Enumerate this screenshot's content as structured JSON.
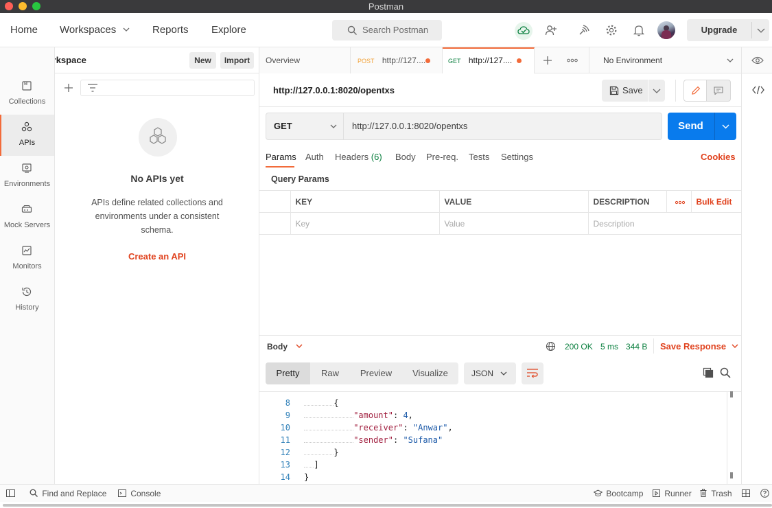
{
  "window": {
    "title": "Postman"
  },
  "topbar": {
    "nav": [
      "Home",
      "Workspaces",
      "Reports",
      "Explore"
    ],
    "search_placeholder": "Search Postman",
    "upgrade_label": "Upgrade"
  },
  "workspace": {
    "name": "My Workspace",
    "new_label": "New",
    "import_label": "Import"
  },
  "sidebar": {
    "items": [
      {
        "label": "Collections",
        "icon": "collections-icon"
      },
      {
        "label": "APIs",
        "icon": "apis-icon"
      },
      {
        "label": "Environments",
        "icon": "environments-icon"
      },
      {
        "label": "Mock Servers",
        "icon": "mock-servers-icon"
      },
      {
        "label": "Monitors",
        "icon": "monitors-icon"
      },
      {
        "label": "History",
        "icon": "history-icon"
      }
    ]
  },
  "apis_panel": {
    "empty_title": "No APIs yet",
    "empty_desc": "APIs define related collections and environments under a consistent schema.",
    "create_label": "Create an API"
  },
  "tabs": {
    "overview": "Overview",
    "tab1": {
      "method": "POST",
      "url": "http://127...."
    },
    "tab2": {
      "method": "GET",
      "url": "http://127...."
    },
    "environment": "No Environment"
  },
  "request": {
    "name": "http://127.0.0.1:8020/opentxs",
    "save_label": "Save",
    "method": "GET",
    "url": "http://127.0.0.1:8020/opentxs",
    "send_label": "Send",
    "subtabs": [
      "Params",
      "Auth",
      "Headers",
      "Body",
      "Pre-req.",
      "Tests",
      "Settings"
    ],
    "headers_count": "(6)",
    "cookies_label": "Cookies",
    "query_params_label": "Query Params",
    "table_headers": {
      "key": "KEY",
      "value": "VALUE",
      "description": "DESCRIPTION",
      "bulk_edit": "Bulk Edit"
    },
    "placeholders": {
      "key": "Key",
      "value": "Value",
      "description": "Description"
    }
  },
  "response": {
    "body_label": "Body",
    "status": "200 OK",
    "time": "5 ms",
    "size": "344 B",
    "save_response": "Save Response",
    "views": [
      "Pretty",
      "Raw",
      "Preview",
      "Visualize"
    ],
    "format": "JSON",
    "code": [
      {
        "n": "8",
        "text": "{"
      },
      {
        "n": "9",
        "key": "\"amount\"",
        "val": "4",
        "tail": ","
      },
      {
        "n": "10",
        "key": "\"receiver\"",
        "val": "\"Anwar\"",
        "tail": ","
      },
      {
        "n": "11",
        "key": "\"sender\"",
        "val": "\"Sufana\"",
        "tail": ""
      },
      {
        "n": "12",
        "text": "}"
      },
      {
        "n": "13",
        "text": "]"
      },
      {
        "n": "14",
        "text": "}"
      }
    ]
  },
  "footer": {
    "find_replace": "Find and Replace",
    "console": "Console",
    "bootcamp": "Bootcamp",
    "runner": "Runner",
    "trash": "Trash"
  },
  "colors": {
    "accent": "#f26b3a",
    "send": "#097bed",
    "status_ok": "#0c8040",
    "create": "#e0431f"
  }
}
